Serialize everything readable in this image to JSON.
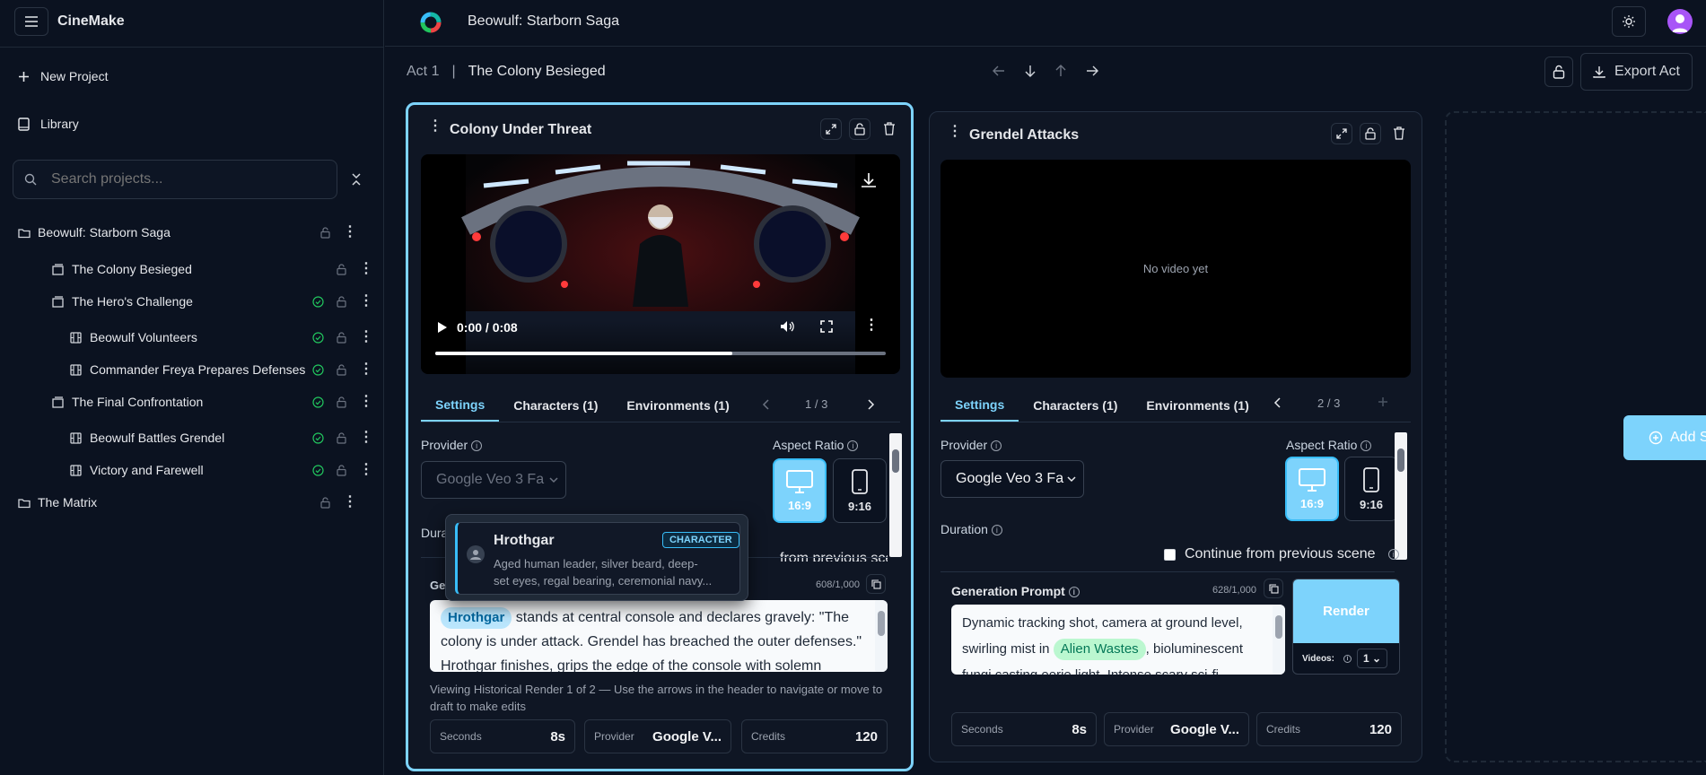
{
  "app": {
    "name": "CineMake"
  },
  "sidebar": {
    "new_project": "New Project",
    "library": "Library",
    "search_placeholder": "Search projects...",
    "tree": [
      {
        "label": "Beowulf: Starborn Saga",
        "level": 0,
        "type": "project",
        "status": "none"
      },
      {
        "label": "The Colony Besieged",
        "level": 1,
        "type": "act",
        "status": "none"
      },
      {
        "label": "The Hero's Challenge",
        "level": 1,
        "type": "act",
        "status": "complete"
      },
      {
        "label": "Beowulf Volunteers",
        "level": 2,
        "type": "scene",
        "status": "complete"
      },
      {
        "label": "Commander Freya Prepares Defenses",
        "level": 2,
        "type": "scene",
        "status": "complete"
      },
      {
        "label": "The Final Confrontation",
        "level": 1,
        "type": "act",
        "status": "complete"
      },
      {
        "label": "Beowulf Battles Grendel",
        "level": 2,
        "type": "scene",
        "status": "complete"
      },
      {
        "label": "Victory and Farewell",
        "level": 2,
        "type": "scene",
        "status": "complete"
      },
      {
        "label": "The Matrix",
        "level": 0,
        "type": "project",
        "status": "none"
      }
    ]
  },
  "header": {
    "project_title": "Beowulf: Starborn Saga"
  },
  "act_bar": {
    "act": "Act 1",
    "separator": "|",
    "title": "The Colony Besieged",
    "export_label": "Export Act"
  },
  "scene1": {
    "title": "Colony Under Threat",
    "video_time": "0:00 / 0:08",
    "video_progress": 0.66,
    "tabs": [
      "Settings",
      "Characters (1)",
      "Environments (1)"
    ],
    "page": "1 / 3",
    "provider_label": "Provider",
    "provider_value": "Google Veo 3 Fa",
    "aspect_label": "Aspect Ratio",
    "aspect_options": [
      "16:9",
      "9:16"
    ],
    "duration_label": "Dura",
    "continue_partial": "from previous scene",
    "gen_label": "Generation",
    "char_count": "608/1,000",
    "prompt_chip": "Hrothgar",
    "prompt_text_1": " stands at central console and declares gravely: \"The",
    "prompt_text_2": "colony is under attack. Grendel has breached the outer defenses.\"",
    "prompt_text_3": "Hrothgar finishes, grips the edge of the console with solemn",
    "history_note": "Viewing Historical Render 1 of 2 — Use the arrows in the header to navigate or move to draft to make edits",
    "stats": [
      {
        "label": "Seconds",
        "value": "8s"
      },
      {
        "label": "Provider",
        "value": "Google V..."
      },
      {
        "label": "Credits",
        "value": "120"
      }
    ]
  },
  "tooltip": {
    "name": "Hrothgar",
    "badge": "CHARACTER",
    "desc_1": "Aged human leader, silver beard, deep-",
    "desc_2": "set eyes, regal bearing, ceremonial navy..."
  },
  "scene2": {
    "title": "Grendel Attacks",
    "no_video": "No video yet",
    "tabs": [
      "Settings",
      "Characters (1)",
      "Environments (1)"
    ],
    "page": "2 / 3",
    "provider_label": "Provider",
    "provider_value": "Google Veo 3 Fa",
    "aspect_label": "Aspect Ratio",
    "aspect_options": [
      "16:9",
      "9:16"
    ],
    "duration_label": "Duration",
    "continue_label": "Continue from previous scene",
    "gen_label": "Generation Prompt",
    "char_count": "628/1,000",
    "prompt_text_1": "Dynamic tracking shot, camera at ground level,",
    "prompt_text_2a": "swirling mist in ",
    "prompt_chip": "Alien Wastes",
    "prompt_text_2b": ", bioluminescent",
    "prompt_text_3": "fungi casting eerie light. Intense scary sci-fi",
    "render_label": "Render",
    "videos_label": "Videos:",
    "videos_value": "1",
    "stats": [
      {
        "label": "Seconds",
        "value": "8s"
      },
      {
        "label": "Provider",
        "value": "Google V..."
      },
      {
        "label": "Credits",
        "value": "120"
      }
    ]
  },
  "add_scene_partial": "Add S",
  "colors": {
    "accent": "#7dd3fc",
    "bg": "#0b1220",
    "success": "#22c55e",
    "chip_character": "#38bdf8",
    "chip_environment": "#34d399"
  }
}
